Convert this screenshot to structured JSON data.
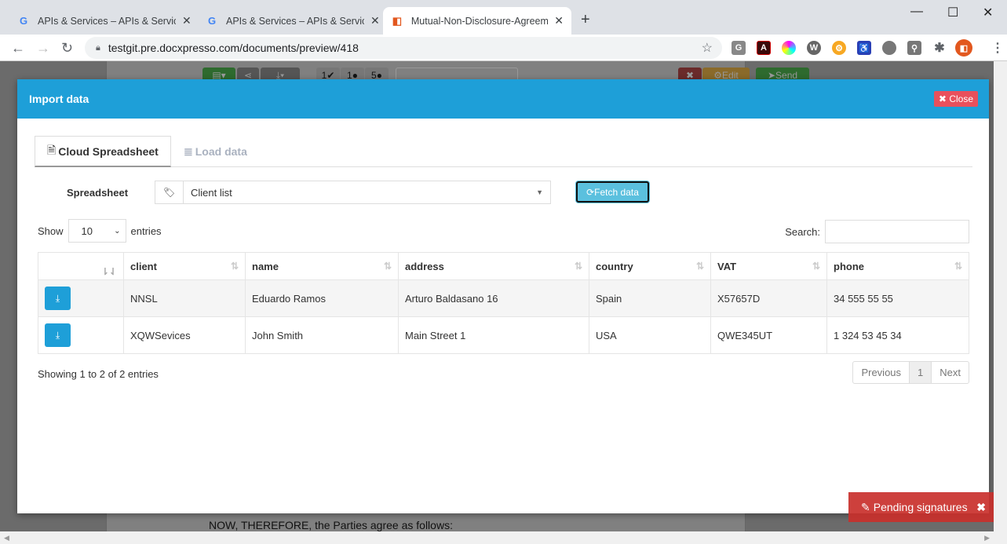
{
  "browser": {
    "tabs": [
      {
        "title": "APIs & Services – APIs & Services",
        "icon": "google-icon",
        "active": false
      },
      {
        "title": "APIs & Services – APIs & Services",
        "icon": "google-icon",
        "active": false
      },
      {
        "title": "Mutual-Non-Disclosure-Agreement",
        "icon": "docxpresso-icon",
        "active": true
      }
    ],
    "url": "testgit.pre.docxpresso.com/documents/preview/418"
  },
  "background": {
    "counts": [
      "1",
      "1",
      "5"
    ],
    "edit_label": "Edit",
    "send_label": "Send",
    "doc_text": "NOW, THEREFORE, the Parties agree as follows:"
  },
  "modal": {
    "title": "Import data",
    "close_label": "Close",
    "tabs": [
      "Cloud Spreadsheet",
      "Load data"
    ],
    "spreadsheet_label": "Spreadsheet",
    "spreadsheet_value": "Client list",
    "fetch_label": "Fetch data",
    "show_label": "Show",
    "entries_value": "10",
    "entries_label": "entries",
    "search_label": "Search:",
    "columns": [
      "client",
      "name",
      "address",
      "country",
      "VAT",
      "phone"
    ],
    "rows": [
      [
        "NNSL",
        "Eduardo Ramos",
        "Arturo Baldasano 16",
        "Spain",
        "X57657D",
        "34 555 55 55"
      ],
      [
        "XQWSevices",
        "John Smith",
        "Main Street 1",
        "USA",
        "QWE345UT",
        "1 324 53 45 34"
      ]
    ],
    "info": "Showing 1 to 2 of 2 entries",
    "pager": [
      "Previous",
      "1",
      "Next"
    ]
  },
  "pending": {
    "label": "Pending signatures"
  },
  "colors": {
    "header": "#1e9fd8",
    "close": "#e9505c",
    "fetch": "#5bc0de",
    "pending": "#c9302c"
  }
}
